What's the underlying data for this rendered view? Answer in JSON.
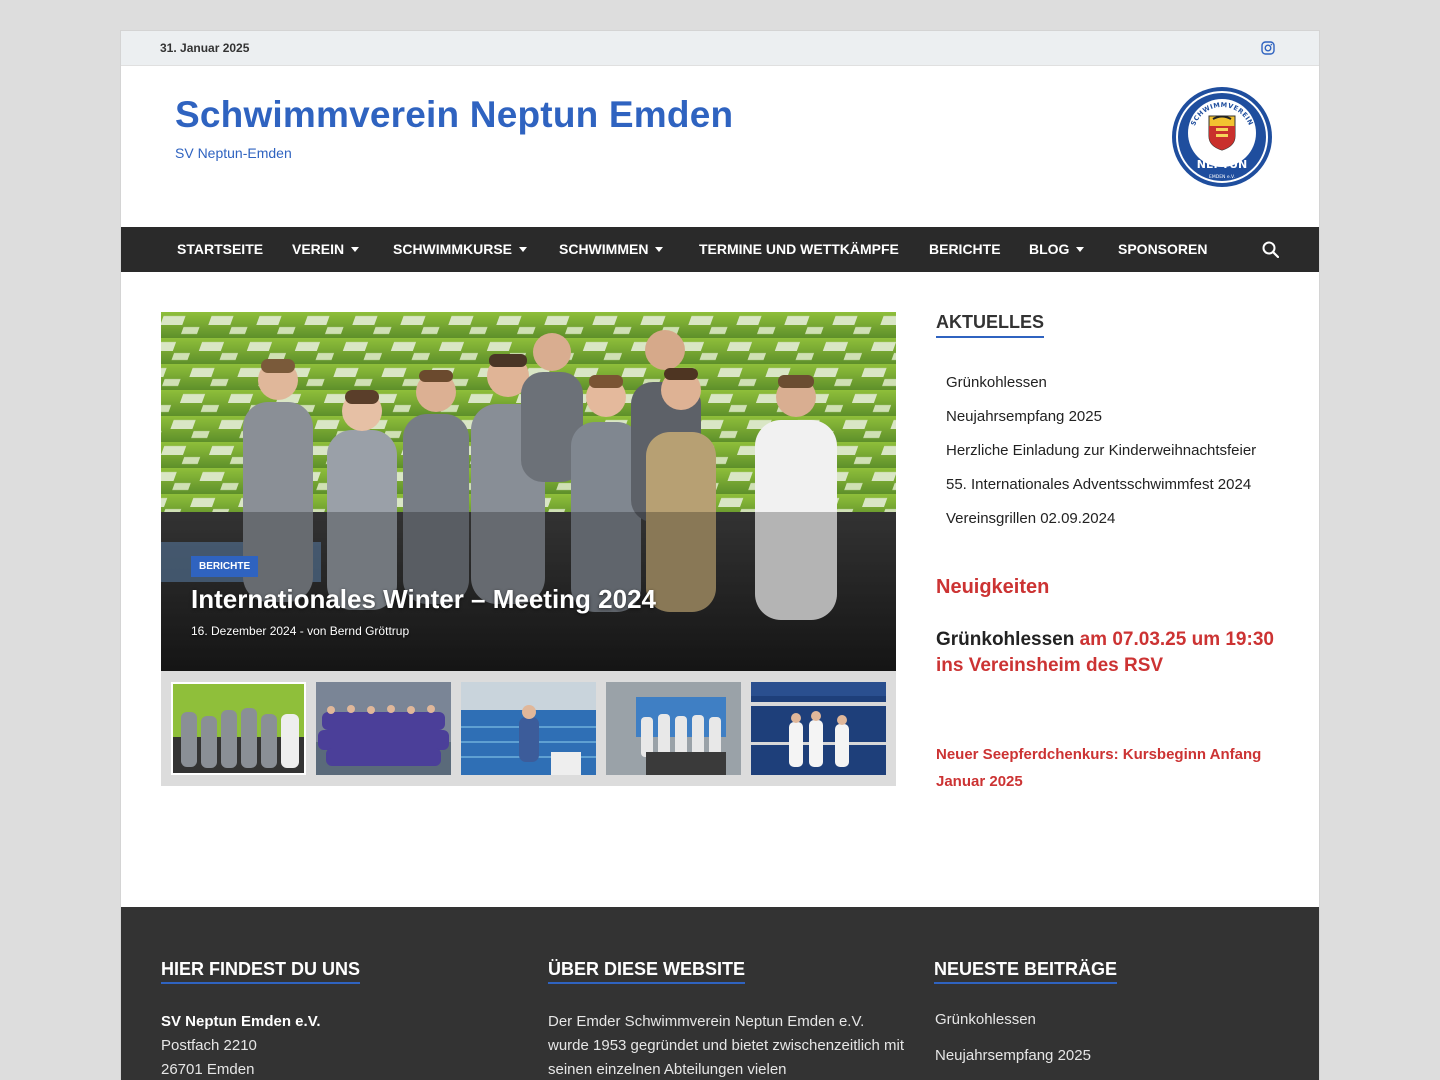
{
  "topbar": {
    "date": "31. Januar 2025",
    "social_icon": "instagram-icon"
  },
  "header": {
    "title": "Schwimmverein Neptun Emden",
    "tagline": "SV Neptun-Emden",
    "logo": {
      "ring_text": "SCHWIMMVEREIN",
      "name": "NEPTUN",
      "city": "EMDEN e.V."
    }
  },
  "nav": {
    "items": [
      {
        "label": "Startseite",
        "dropdown": false
      },
      {
        "label": "Verein",
        "dropdown": true
      },
      {
        "label": "Schwimmkurse",
        "dropdown": true
      },
      {
        "label": "Schwimmen",
        "dropdown": true
      },
      {
        "label": "Termine und Wettkämpfe",
        "dropdown": false
      },
      {
        "label": "Berichte",
        "dropdown": false
      },
      {
        "label": "Blog",
        "dropdown": true
      },
      {
        "label": "Sponsoren",
        "dropdown": false
      }
    ],
    "search_icon": "search-icon"
  },
  "slider": {
    "category": "Berichte",
    "title": "Internationales Winter – Meeting 2024",
    "meta": "16. Dezember 2024 - von Bernd Gröttrup",
    "thumbnails": [
      {
        "active": true
      },
      {
        "active": false
      },
      {
        "active": false
      },
      {
        "active": false
      },
      {
        "active": false
      }
    ]
  },
  "sidebar": {
    "aktuelles_title": "Aktuelles",
    "aktuelles": [
      "Grünkohlessen",
      "Neujahrsempfang 2025",
      "Herzliche Einladung zur Kinderweihnachtsfeier",
      "55. Internationales Adventsschwimmfest 2024",
      "Vereinsgrillen 02.09.2024"
    ],
    "neuigkeiten_title": "Neuigkeiten",
    "news_big_dark": "Grünkohlessen",
    "news_big_red": " am 07.03.25 um 19:30 ins Vereinsheim des RSV",
    "news_small": "Neuer Seepferdchenkurs: Kursbeginn Anfang Januar 2025"
  },
  "footer": {
    "col1": {
      "title": "Hier findest du uns",
      "name": "SV Neptun Emden e.V.",
      "line1": "Postfach 2210",
      "line2": "26701 Emden"
    },
    "col2": {
      "title": "Über diese Website",
      "text": "Der Emder Schwimmverein Neptun Emden e.V. wurde 1953 gegründet und bietet zwischenzeitlich mit seinen einzelnen Abteilungen vielen"
    },
    "col3": {
      "title": "Neueste Beiträge",
      "links": [
        "Grünkohlessen",
        "Neujahrsempfang 2025"
      ]
    }
  },
  "colors": {
    "brand": "#2f63c0",
    "accent_red": "#cc3333",
    "nav_bg": "#2a2a2a",
    "footer_bg": "#333333"
  }
}
